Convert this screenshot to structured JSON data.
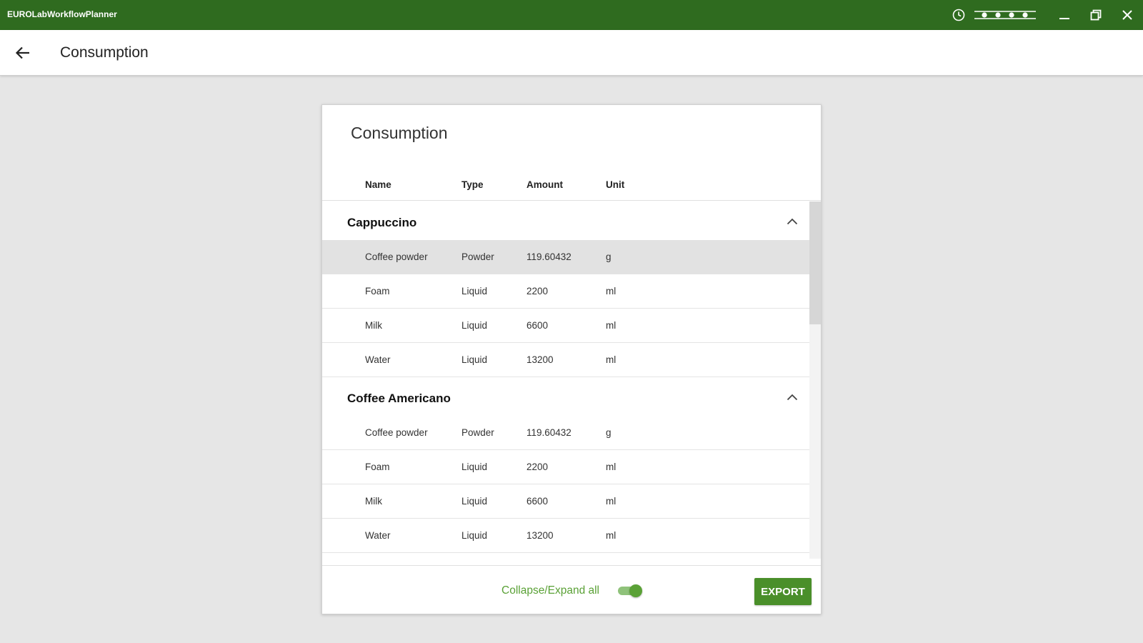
{
  "window": {
    "app_title": "EUROLabWorkflowPlanner",
    "icons": [
      "clock-icon",
      "dots-slider-icon",
      "minimize-icon",
      "restore-icon",
      "close-icon"
    ],
    "bar_color": "#2f6b1f"
  },
  "header": {
    "title": "Consumption",
    "back_icon": "arrow-left-icon"
  },
  "card": {
    "title": "Consumption",
    "columns": {
      "name": "Name",
      "type": "Type",
      "amount": "Amount",
      "unit": "Unit"
    },
    "groups": [
      {
        "title": "Cappuccino",
        "expanded": true,
        "rows": [
          {
            "name": "Coffee powder",
            "type": "Powder",
            "amount": "119.60432",
            "unit": "g",
            "selected": true
          },
          {
            "name": "Foam",
            "type": "Liquid",
            "amount": "2200",
            "unit": "ml"
          },
          {
            "name": "Milk",
            "type": "Liquid",
            "amount": "6600",
            "unit": "ml"
          },
          {
            "name": "Water",
            "type": "Liquid",
            "amount": "13200",
            "unit": "ml"
          }
        ]
      },
      {
        "title": "Coffee Americano",
        "expanded": true,
        "rows": [
          {
            "name": "Coffee powder",
            "type": "Powder",
            "amount": "119.60432",
            "unit": "g"
          },
          {
            "name": "Foam",
            "type": "Liquid",
            "amount": "2200",
            "unit": "ml"
          },
          {
            "name": "Milk",
            "type": "Liquid",
            "amount": "6600",
            "unit": "ml"
          },
          {
            "name": "Water",
            "type": "Liquid",
            "amount": "13200",
            "unit": "ml"
          }
        ]
      }
    ],
    "footer": {
      "toggle_label": "Collapse/Expand all",
      "toggle_on": true,
      "export_label": "EXPORT"
    }
  },
  "colors": {
    "accent": "#5aa136",
    "button": "#4a8f2a"
  }
}
